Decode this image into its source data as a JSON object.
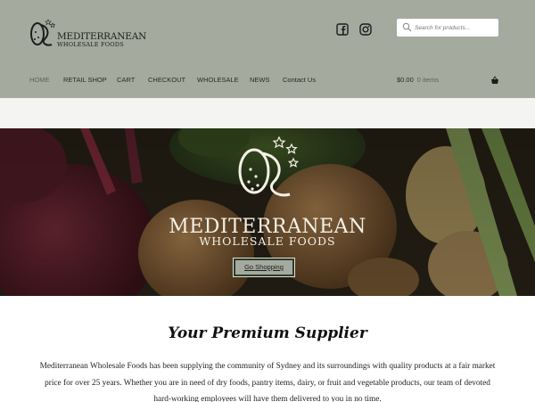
{
  "brand": {
    "name_line1": "MEDITERRANEAN",
    "name_line2": "WHOLESALE FOODS"
  },
  "social": {
    "icons": [
      "facebook-icon",
      "instagram-icon"
    ]
  },
  "search": {
    "placeholder": "Search for products..."
  },
  "nav": {
    "items": [
      {
        "label": "HOME",
        "active": true
      },
      {
        "label": "RETAIL SHOP"
      },
      {
        "label": "CART"
      },
      {
        "label": "CHECKOUT"
      },
      {
        "label": "WHOLESALE"
      },
      {
        "label": "NEWS"
      },
      {
        "label": "Contact Us"
      }
    ]
  },
  "cart": {
    "total": "$0.00",
    "items": "0 items"
  },
  "hero": {
    "title": "MEDITERRANEAN",
    "subtitle": "WHOLESALE FOODS",
    "cta_label": "Go Shopping"
  },
  "content": {
    "heading": "Your Premium Supplier",
    "body": "Mediterranean Wholesale Foods has been supplying the community of Sydney and its surroundings with quality products at a fair market price for over 25 years. Whether you are in need of dry foods, pantry items, dairy, or fruit and vegetable products, our team of devoted hard-working employees will have them delivered to you in no time."
  },
  "colors": {
    "header_bg": "#a4aa9d",
    "accent_text": "#5e6457",
    "band_bg": "#f4f4f2"
  }
}
